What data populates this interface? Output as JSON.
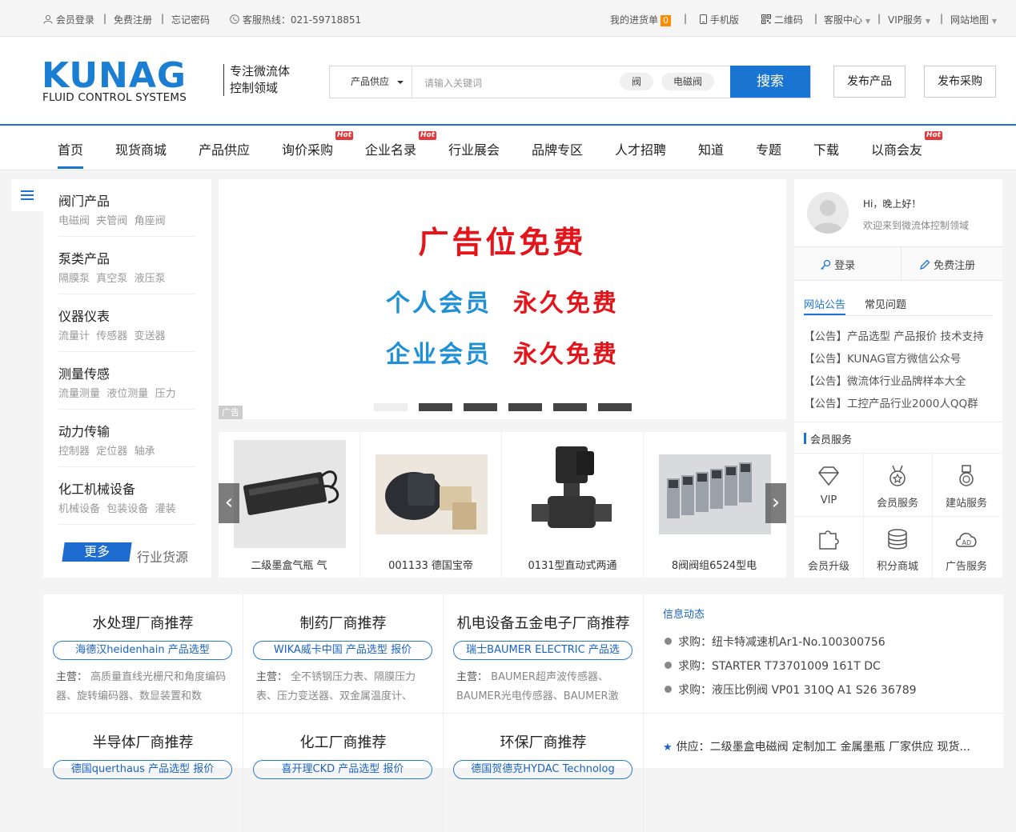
{
  "topbar": {
    "login": "会员登录",
    "register": "免费注册",
    "forgot": "忘记密码",
    "hotline": "客服热线：021-59718851",
    "cart": "我的进货单",
    "cart_count": "0",
    "mobile": "手机版",
    "qrcode": "二维码",
    "service": "客服中心",
    "vip": "VIP服务",
    "sitemap": "网站地图"
  },
  "header": {
    "logo_main": "KUNAG",
    "logo_sub": "FLUID CONTROL SYSTEMS",
    "slogan": "专注微流体控制领域",
    "search_select": "产品供应",
    "search_placeholder": "请输入关键词",
    "search_tags": [
      "阀",
      "电磁阀"
    ],
    "search_button": "搜索",
    "publish_product": "发布产品",
    "publish_purchase": "发布采购"
  },
  "nav": {
    "items": [
      {
        "label": "首页",
        "hot": false
      },
      {
        "label": "现货商城",
        "hot": false
      },
      {
        "label": "产品供应",
        "hot": false
      },
      {
        "label": "询价采购",
        "hot": true
      },
      {
        "label": "企业名录",
        "hot": true
      },
      {
        "label": "行业展会",
        "hot": false
      },
      {
        "label": "品牌专区",
        "hot": false
      },
      {
        "label": "人才招聘",
        "hot": false
      },
      {
        "label": "知道",
        "hot": false
      },
      {
        "label": "专题",
        "hot": false
      },
      {
        "label": "下载",
        "hot": false
      },
      {
        "label": "以商会友",
        "hot": true
      }
    ],
    "hot_label": "Hot"
  },
  "categories": [
    {
      "title": "阀门产品",
      "subs": [
        "电磁阀",
        "夹管阀",
        "角座阀"
      ]
    },
    {
      "title": "泵类产品",
      "subs": [
        "隔膜泵",
        "真空泵",
        "液压泵"
      ]
    },
    {
      "title": "仪器仪表",
      "subs": [
        "流量计",
        "传感器",
        "变送器"
      ]
    },
    {
      "title": "测量传感",
      "subs": [
        "流量测量",
        "液位测量",
        "压力"
      ]
    },
    {
      "title": "动力传输",
      "subs": [
        "控制器",
        "定位器",
        "轴承"
      ]
    },
    {
      "title": "化工机械设备",
      "subs": [
        "机械设备",
        "包装设备",
        "灌装"
      ]
    }
  ],
  "more_button": "更多",
  "industry_source": "行业货源",
  "banner": {
    "line1": "广告位免费",
    "line2a": "个人会员",
    "line2b": "永久免费",
    "line3a": "企业会员",
    "line3b": "永久免费",
    "ad_label": "广告",
    "colors": {
      "red": "#e4141b",
      "blue": "#1f8fd6"
    }
  },
  "products": [
    {
      "name": "二级墨盒气瓶 气"
    },
    {
      "name": "001133 德国宝帝"
    },
    {
      "name": "0131型直动式两通"
    },
    {
      "name": "8阀阀组6524型电"
    }
  ],
  "user": {
    "greeting": "Hi，晚上好！",
    "welcome": "欢迎来到微流体控制领域",
    "login": "登录",
    "register": "免费注册"
  },
  "notice_tabs": [
    "网站公告",
    "常见问题"
  ],
  "notices": [
    "【公告】产品选型 产品报价 技术支持",
    "【公告】KUNAG官方微信公众号",
    "【公告】微流体行业品牌样本大全",
    "【公告】工控产品行业2000人QQ群"
  ],
  "member_service_title": "会员服务",
  "services": [
    {
      "label": "VIP",
      "icon": "diamond-icon"
    },
    {
      "label": "会员服务",
      "icon": "medal-icon"
    },
    {
      "label": "建站服务",
      "icon": "award-icon"
    },
    {
      "label": "会员升级",
      "icon": "puzzle-icon"
    },
    {
      "label": "积分商城",
      "icon": "coins-icon"
    },
    {
      "label": "广告服务",
      "icon": "ad-cloud-icon"
    }
  ],
  "recommend": [
    {
      "title": "水处理厂商推荐",
      "pill": "海德汉heidenhain 产品选型",
      "main_label": "主营：",
      "main": "高质量直线光栅尺和角度编码器、旋转编码器、数显装置和数"
    },
    {
      "title": "制药厂商推荐",
      "pill": "WIKA威卡中国 产品选型 报价",
      "main_label": "主营：",
      "main": "全不锈钢压力表、隔膜压力表、压力变送器、双金属温度计、"
    },
    {
      "title": "机电设备五金电子厂商推荐",
      "pill": "瑞士BAUMER ELECTRIC 产品选",
      "main_label": "主营：",
      "main": "BAUMER超声波传感器、BAUMER光电传感器、BAUMER激"
    },
    {
      "title": "半导体厂商推荐",
      "pill": "德国querthaus 产品选型 报价",
      "main_label": "",
      "main": ""
    },
    {
      "title": "化工厂商推荐",
      "pill": "喜开理CKD 产品选型 报价",
      "main_label": "",
      "main": ""
    },
    {
      "title": "环保厂商推荐",
      "pill": "德国贺德克HYDAC Technolog",
      "main_label": "",
      "main": ""
    }
  ],
  "info": {
    "title": "信息动态",
    "items": [
      "求购：纽卡特减速机Ar1-No.100300756",
      "求购：STARTER T73701009 161T DC",
      "求购：液压比例阀 VP01 310Q A1 S26 36789"
    ],
    "supply": [
      "供应：二级墨盒电磁阀 定制加工 金属墨瓶 厂家供应 现货..."
    ]
  }
}
